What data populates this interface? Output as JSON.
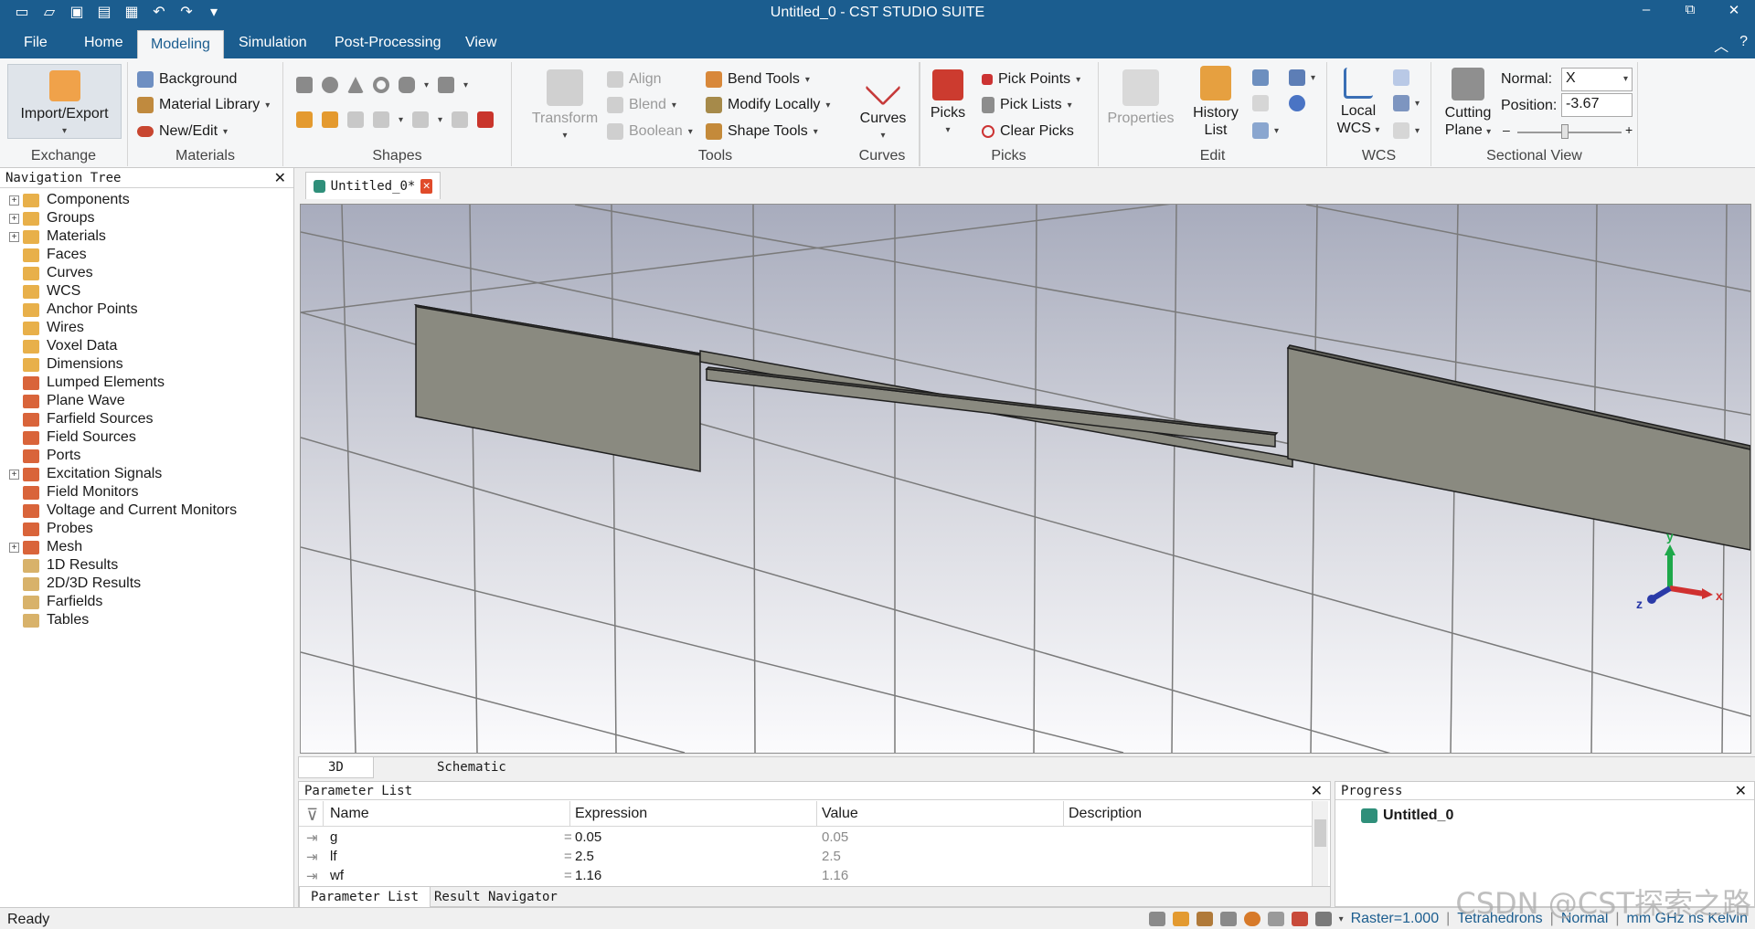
{
  "window": {
    "title": "Untitled_0 - CST STUDIO SUITE",
    "controls": [
      "–",
      "⧉",
      "✕"
    ]
  },
  "quick_access": [
    "new-icon",
    "open-icon",
    "save-icon",
    "save-all-icon",
    "print-icon",
    "undo-icon",
    "redo-icon",
    "customize-icon"
  ],
  "menu": {
    "tabs": [
      "File",
      "Home",
      "Modeling",
      "Simulation",
      "Post-Processing",
      "View"
    ],
    "active": "Modeling"
  },
  "ribbon": {
    "exchange": {
      "label": "Exchange",
      "import_export": "Import/Export"
    },
    "materials": {
      "label": "Materials",
      "background": "Background",
      "material_library": "Material Library",
      "new_edit": "New/Edit"
    },
    "shapes": {
      "label": "Shapes"
    },
    "tools": {
      "label": "Tools",
      "transform": "Transform",
      "align": "Align",
      "blend": "Blend",
      "boolean": "Boolean",
      "bend_tools": "Bend Tools",
      "modify_locally": "Modify Locally",
      "shape_tools": "Shape Tools"
    },
    "curves": {
      "label": "Curves",
      "curves_btn": "Curves"
    },
    "picks": {
      "label": "Picks",
      "picks_btn": "Picks",
      "pick_points": "Pick Points",
      "pick_lists": "Pick Lists",
      "clear_picks": "Clear Picks"
    },
    "edit": {
      "label": "Edit",
      "properties": "Properties",
      "history_list_1": "History",
      "history_list_2": "List"
    },
    "wcs": {
      "label": "WCS",
      "local_1": "Local",
      "local_2": "WCS"
    },
    "sectional": {
      "label": "Sectional View",
      "cutting_1": "Cutting",
      "cutting_2": "Plane",
      "normal_label": "Normal:",
      "normal_value": "X",
      "position_label": "Position:",
      "position_value": "-3.67",
      "slider_minus": "–",
      "slider_plus": "+"
    }
  },
  "nav": {
    "title": "Navigation Tree",
    "items": [
      {
        "label": "Components",
        "expandable": true,
        "icon": "folder-icon"
      },
      {
        "label": "Groups",
        "expandable": true,
        "icon": "folder-icon"
      },
      {
        "label": "Materials",
        "expandable": true,
        "icon": "folder-icon"
      },
      {
        "label": "Faces",
        "expandable": false,
        "icon": "folder-icon"
      },
      {
        "label": "Curves",
        "expandable": false,
        "icon": "folder-icon"
      },
      {
        "label": "WCS",
        "expandable": false,
        "icon": "folder-icon"
      },
      {
        "label": "Anchor Points",
        "expandable": false,
        "icon": "folder-icon"
      },
      {
        "label": "Wires",
        "expandable": false,
        "icon": "folder-icon"
      },
      {
        "label": "Voxel Data",
        "expandable": false,
        "icon": "folder-icon"
      },
      {
        "label": "Dimensions",
        "expandable": false,
        "icon": "folder-icon"
      },
      {
        "label": "Lumped Elements",
        "expandable": false,
        "icon": "source-folder-icon"
      },
      {
        "label": "Plane Wave",
        "expandable": false,
        "icon": "source-folder-icon"
      },
      {
        "label": "Farfield Sources",
        "expandable": false,
        "icon": "source-folder-icon"
      },
      {
        "label": "Field Sources",
        "expandable": false,
        "icon": "source-folder-icon"
      },
      {
        "label": "Ports",
        "expandable": false,
        "icon": "source-folder-icon"
      },
      {
        "label": "Excitation Signals",
        "expandable": true,
        "icon": "source-folder-icon"
      },
      {
        "label": "Field Monitors",
        "expandable": false,
        "icon": "source-folder-icon"
      },
      {
        "label": "Voltage and Current Monitors",
        "expandable": false,
        "icon": "source-folder-icon"
      },
      {
        "label": "Probes",
        "expandable": false,
        "icon": "source-folder-icon"
      },
      {
        "label": "Mesh",
        "expandable": true,
        "icon": "source-folder-icon"
      },
      {
        "label": "1D Results",
        "expandable": false,
        "icon": "results-folder-icon"
      },
      {
        "label": "2D/3D Results",
        "expandable": false,
        "icon": "results-folder-icon"
      },
      {
        "label": "Farfields",
        "expandable": false,
        "icon": "results-folder-icon"
      },
      {
        "label": "Tables",
        "expandable": false,
        "icon": "results-folder-icon"
      }
    ]
  },
  "document": {
    "tab": "Untitled_0*",
    "close": "✕"
  },
  "axes": {
    "x": "x",
    "y": "y",
    "z": "z"
  },
  "view_tabs": {
    "tab_3d": "3D",
    "tab_schematic": "Schematic",
    "active": "3D"
  },
  "params": {
    "title": "Parameter List",
    "columns": [
      "Name",
      "Expression",
      "Value",
      "Description"
    ],
    "rows": [
      {
        "name": "g",
        "expression": "0.05",
        "value": "0.05",
        "description": ""
      },
      {
        "name": "lf",
        "expression": "2.5",
        "value": "2.5",
        "description": ""
      },
      {
        "name": "wf",
        "expression": "1.16",
        "value": "1.16",
        "description": ""
      }
    ],
    "tabs": [
      "Parameter List",
      "Result Navigator"
    ]
  },
  "progress": {
    "title": "Progress",
    "item": "Untitled_0"
  },
  "status": {
    "ready": "Ready",
    "raster": "Raster=1.000",
    "mesh": "Tetrahedrons",
    "mode": "Normal",
    "units": "mm  GHz  ns  Kelvin"
  },
  "watermark": "CSDN @CST探索之路",
  "colors": {
    "accent": "#1b5d8f",
    "model": "#8a8a80",
    "viewport_top": "#a7abbc",
    "viewport_bottom": "#ffffff"
  }
}
